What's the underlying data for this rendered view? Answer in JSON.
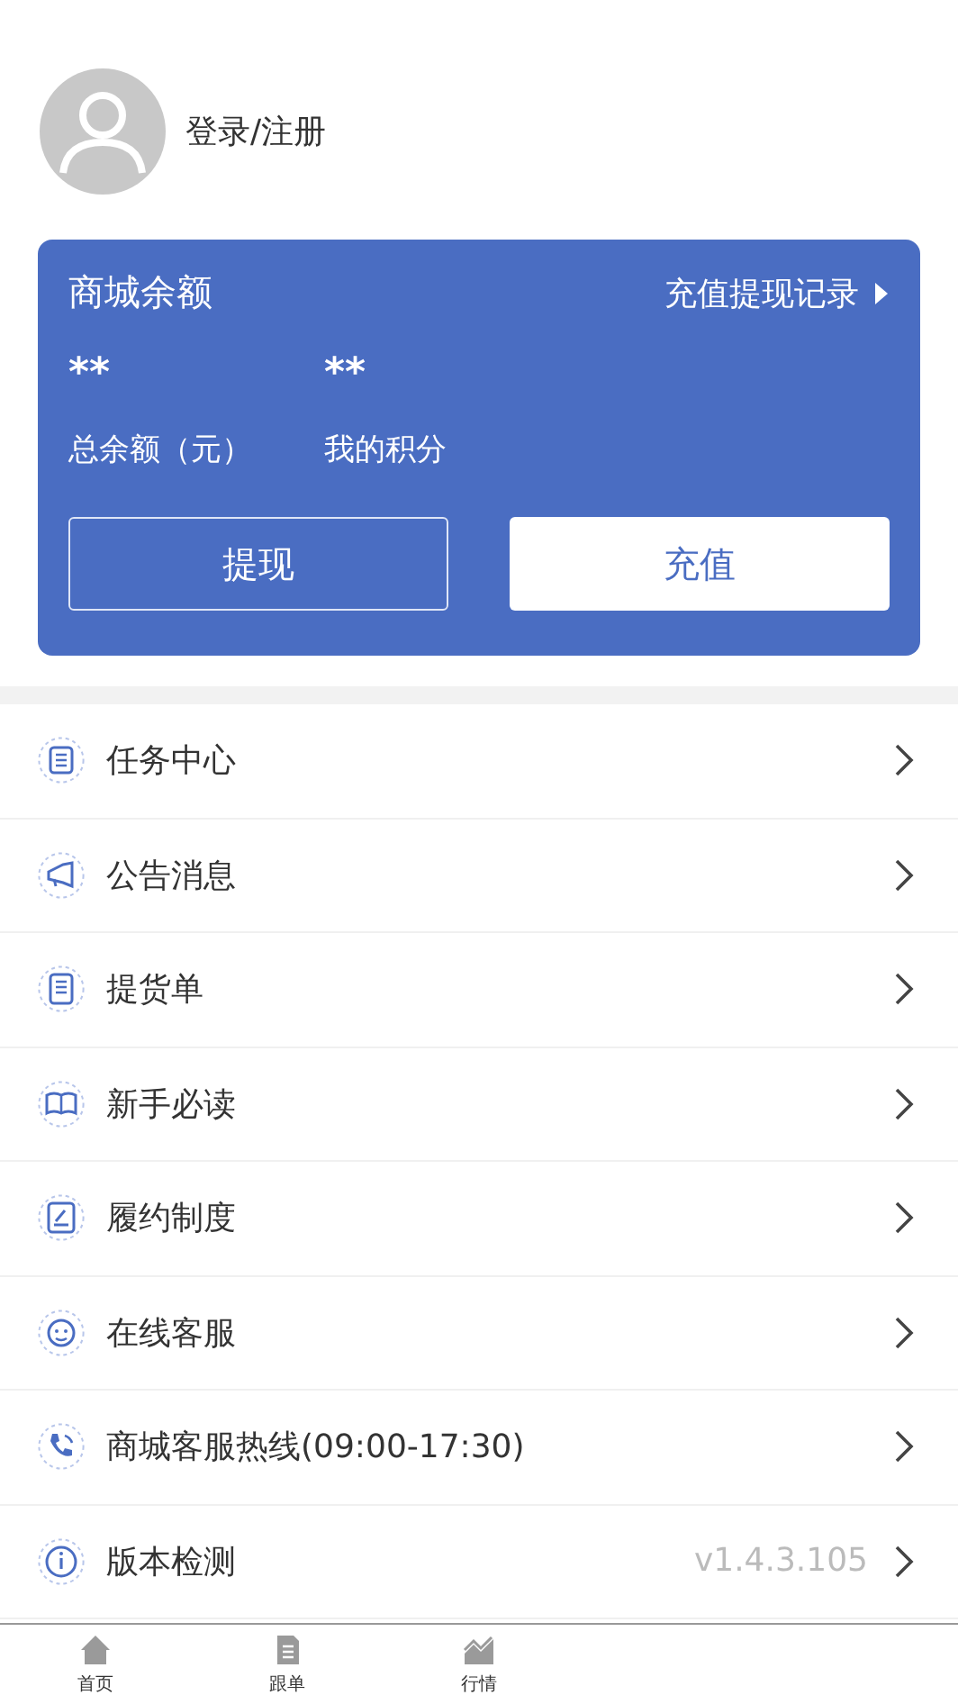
{
  "profile": {
    "login": "登录/注册"
  },
  "balance_card": {
    "title": "商城余额",
    "records_link": "充值提现记录",
    "stats": [
      {
        "value": "**",
        "label": "总余额（元）"
      },
      {
        "value": "**",
        "label": "我的积分"
      }
    ],
    "buttons": [
      {
        "label": "提现",
        "kind": "outline"
      },
      {
        "label": "充值",
        "kind": "solid"
      }
    ]
  },
  "menu": [
    {
      "label": "任务中心"
    },
    {
      "label": "公告消息"
    },
    {
      "label": "提货单"
    },
    {
      "label": "新手必读"
    },
    {
      "label": "履约制度"
    },
    {
      "label": "在线客服"
    },
    {
      "label": "商城客服热线(09:00-17:30)"
    },
    {
      "label": "版本检测",
      "value": "v1.4.3.105"
    }
  ],
  "tab_bar": [
    {
      "label": "首页",
      "selected": false
    },
    {
      "label": "跟单",
      "selected": false
    },
    {
      "label": "行情",
      "selected": false
    }
  ]
}
